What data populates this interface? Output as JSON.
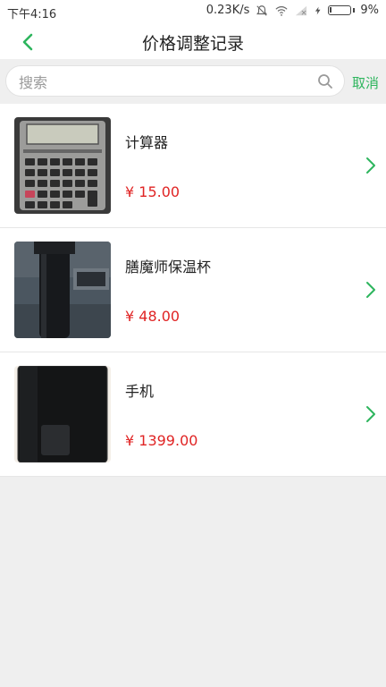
{
  "status_bar": {
    "time": "下午4:16",
    "network_speed": "0.23K/s",
    "battery_percent": "9%",
    "battery_level": 0.09,
    "icons": [
      "mute-bell-icon",
      "wifi-icon",
      "signal-icon",
      "charging-bolt-icon",
      "battery-icon"
    ]
  },
  "header": {
    "title": "价格调整记录",
    "back_icon": "chevron-left-icon"
  },
  "search": {
    "placeholder": "搜索",
    "value": "",
    "cancel_label": "取消",
    "icon": "search-icon"
  },
  "items": [
    {
      "name": "计算器",
      "price": "¥ 15.00",
      "image": "calculator-photo"
    },
    {
      "name": "膳魔师保温杯",
      "price": "¥ 48.00",
      "image": "thermos-photo"
    },
    {
      "name": "手机",
      "price": "¥ 1399.00",
      "image": "phone-photo"
    }
  ],
  "colors": {
    "accent": "#2db55d",
    "price": "#e02424",
    "background": "#efefef"
  }
}
